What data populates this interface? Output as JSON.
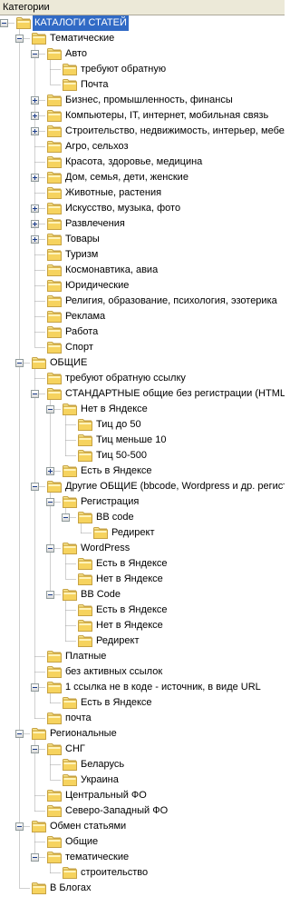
{
  "header": {
    "title": "Категории"
  },
  "tree": [
    {
      "label": "КАТАЛОГИ СТАТЕЙ",
      "depth": 0,
      "toggle": "minus",
      "selected": true
    },
    {
      "label": "Тематические",
      "depth": 1,
      "toggle": "minus"
    },
    {
      "label": "Авто",
      "depth": 2,
      "toggle": "minus"
    },
    {
      "label": "требуют обратную",
      "depth": 3
    },
    {
      "label": "Почта",
      "depth": 3
    },
    {
      "label": "Бизнес, промышленность, финансы",
      "depth": 2,
      "toggle": "plus"
    },
    {
      "label": "Компьютеры, IT, интернет, мобильная связь",
      "depth": 2,
      "toggle": "plus"
    },
    {
      "label": "Строительство, недвижимость, интерьер, мебель",
      "depth": 2,
      "toggle": "plus"
    },
    {
      "label": "Агро, сельхоз",
      "depth": 2
    },
    {
      "label": "Красота, здоровье, медицина",
      "depth": 2
    },
    {
      "label": "Дом, семья, дети, женские",
      "depth": 2,
      "toggle": "plus"
    },
    {
      "label": "Животные, растения",
      "depth": 2
    },
    {
      "label": "Искусство, музыка, фото",
      "depth": 2,
      "toggle": "plus"
    },
    {
      "label": "Развлечения",
      "depth": 2,
      "toggle": "plus"
    },
    {
      "label": "Товары",
      "depth": 2,
      "toggle": "plus"
    },
    {
      "label": "Туризм",
      "depth": 2
    },
    {
      "label": "Космонавтика, авиа",
      "depth": 2
    },
    {
      "label": "Юридические",
      "depth": 2
    },
    {
      "label": "Религия, образование, психология, эзотерика",
      "depth": 2
    },
    {
      "label": "Реклама",
      "depth": 2
    },
    {
      "label": "Работа",
      "depth": 2
    },
    {
      "label": "Спорт",
      "depth": 2
    },
    {
      "label": "ОБЩИЕ",
      "depth": 1,
      "toggle": "minus"
    },
    {
      "label": "требуют обратную ссылку",
      "depth": 2
    },
    {
      "label": "СТАНДАРТНЫЕ общие без регистрации (HTML)",
      "depth": 2,
      "toggle": "minus"
    },
    {
      "label": "Нет в Яндексе",
      "depth": 3,
      "toggle": "minus"
    },
    {
      "label": "Тиц до 50",
      "depth": 4
    },
    {
      "label": "Тиц меньше 10",
      "depth": 4
    },
    {
      "label": "Тиц 50-500",
      "depth": 4
    },
    {
      "label": "Есть в Яндексе",
      "depth": 3,
      "toggle": "plus"
    },
    {
      "label": "Другие ОБЩИЕ (bbcode, Wordpress и др. регистрация)",
      "depth": 2,
      "toggle": "minus"
    },
    {
      "label": "Регистрация",
      "depth": 3,
      "toggle": "minus"
    },
    {
      "label": "BB code",
      "depth": 4,
      "toggle": "minus"
    },
    {
      "label": "Редирект",
      "depth": 5
    },
    {
      "label": "WordPress",
      "depth": 3,
      "toggle": "minus"
    },
    {
      "label": "Есть в Яндексе",
      "depth": 4
    },
    {
      "label": "Нет в Яндексе",
      "depth": 4
    },
    {
      "label": "BB Code",
      "depth": 3,
      "toggle": "minus"
    },
    {
      "label": "Есть в Яндексе",
      "depth": 4
    },
    {
      "label": "Нет в Яндексе",
      "depth": 4
    },
    {
      "label": "Редирект",
      "depth": 4
    },
    {
      "label": "Платные",
      "depth": 2
    },
    {
      "label": "без активных ссылок",
      "depth": 2
    },
    {
      "label": "1 ссылка не в коде - источник, в виде URL",
      "depth": 2,
      "toggle": "minus"
    },
    {
      "label": "Есть в Яндексе",
      "depth": 3
    },
    {
      "label": "почта",
      "depth": 2
    },
    {
      "label": "Региональные",
      "depth": 1,
      "toggle": "minus"
    },
    {
      "label": "СНГ",
      "depth": 2,
      "toggle": "minus"
    },
    {
      "label": "Беларусь",
      "depth": 3
    },
    {
      "label": "Украина",
      "depth": 3
    },
    {
      "label": "Центральный ФО",
      "depth": 2
    },
    {
      "label": "Северо-Западный ФО",
      "depth": 2
    },
    {
      "label": "Обмен статьями",
      "depth": 1,
      "toggle": "minus"
    },
    {
      "label": "Общие",
      "depth": 2
    },
    {
      "label": "тематические",
      "depth": 2,
      "toggle": "minus"
    },
    {
      "label": "строительство",
      "depth": 3
    },
    {
      "label": "В Блогах",
      "depth": 1
    }
  ],
  "colors": {
    "folder_top": "#fbe890",
    "folder_body": "#f6d35e",
    "folder_border": "#c6a243",
    "selection": "#316ac5",
    "guide_line": "#a0a0a0"
  },
  "icons": {
    "folder": "folder-icon",
    "expand": "plus-toggle-icon",
    "collapse": "minus-toggle-icon"
  }
}
